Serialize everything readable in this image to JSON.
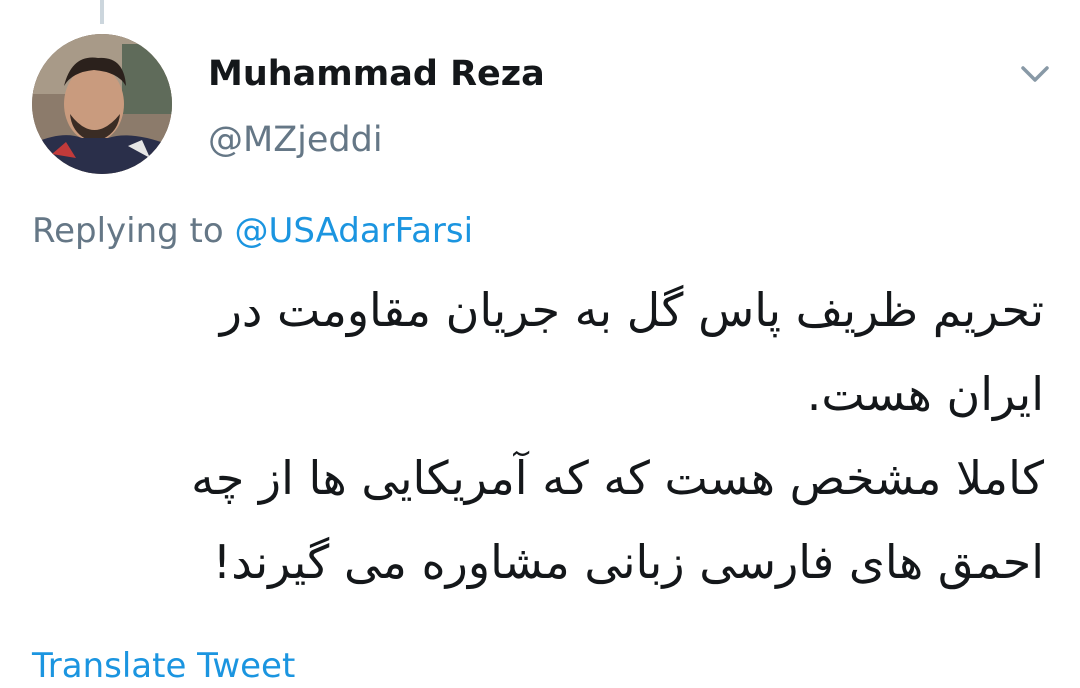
{
  "tweet": {
    "author": {
      "display_name": "Muhammad Reza",
      "handle": "@MZjeddi"
    },
    "replying_prefix": "Replying to",
    "replying_to": "@USAdarFarsi",
    "text_lines": [
      "تحریم ظریف پاس گل به جریان مقاومت در",
      "ایران هست.",
      "کاملا مشخص هست که که آمریکایی ها از چه",
      "احمق های فارسی زبانی مشاوره می گیرند!"
    ],
    "translate_label": "Translate Tweet",
    "menu_icon": "chevron-down-icon"
  },
  "colors": {
    "text_primary": "#14171a",
    "text_secondary": "#657786",
    "link": "#1b95e0",
    "thread_line": "#ccd6dd"
  }
}
